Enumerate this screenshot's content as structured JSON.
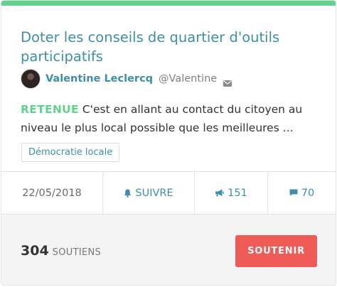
{
  "proposal": {
    "title": "Doter les conseils de quartier d'outils participatifs",
    "author_name": "Valentine Leclercq",
    "author_handle": "@Valentine",
    "status": "RETENUE",
    "summary": "C'est en allant au contact du citoyen au niveau le plus local possible que les meilleures ...",
    "tag": "Démocratie locale"
  },
  "stats": {
    "date": "22/05/2018",
    "follow_label": "SUIVRE",
    "votes": "151",
    "comments": "70"
  },
  "footer": {
    "supports_count": "304",
    "supports_label": "SOUTIENS",
    "support_button": "SOUTENIR"
  },
  "icons": {
    "mail": "envelope-icon",
    "follow": "bell-icon",
    "votes": "megaphone-icon",
    "comments": "speech-bubble-icon"
  },
  "colors": {
    "accent": "#3e8fa7",
    "status": "#5fd38d",
    "button": "#ef5b56"
  }
}
